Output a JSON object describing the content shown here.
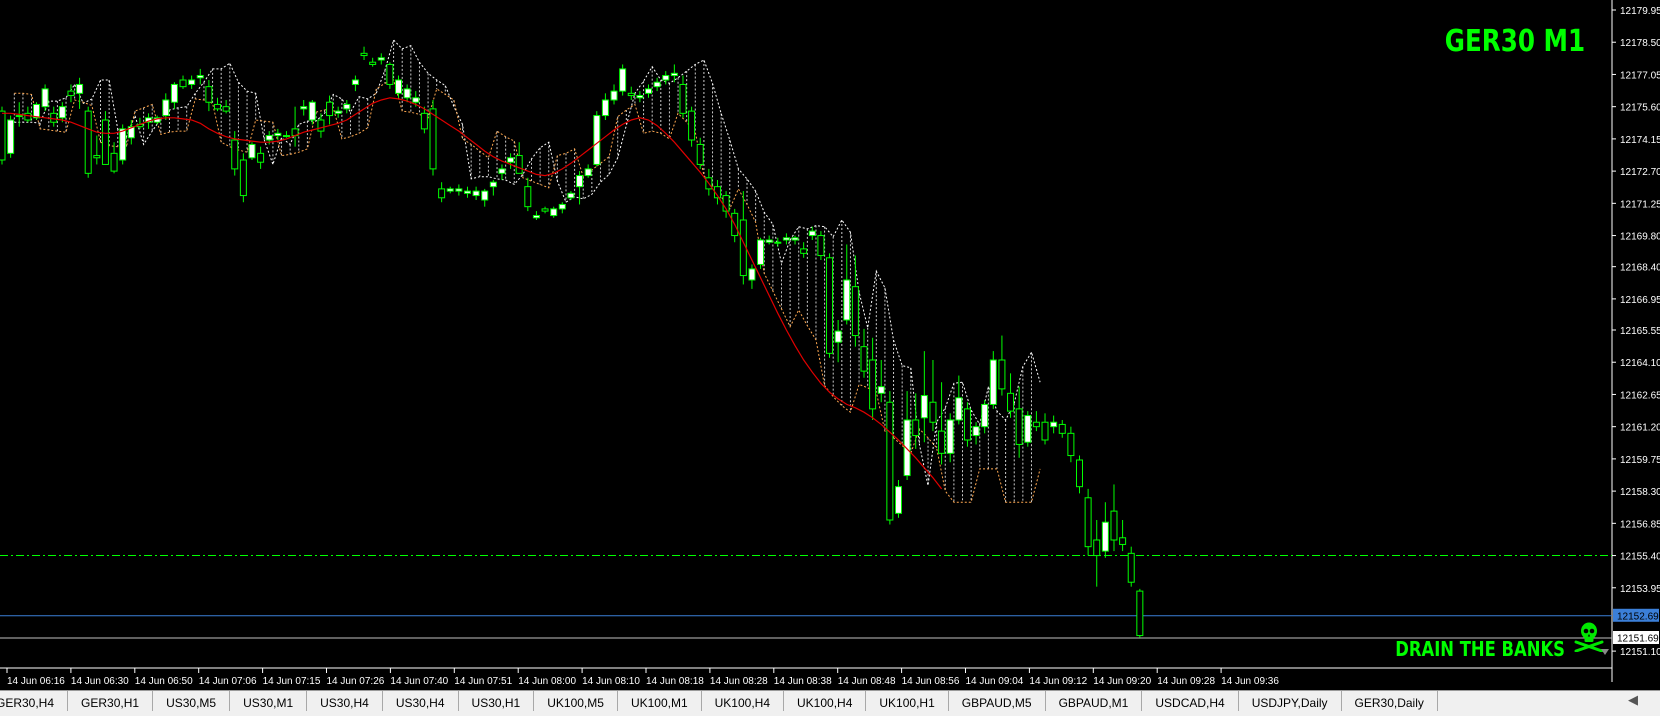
{
  "window": {
    "title": "GER30 M1"
  },
  "watermark": {
    "text": "DRAIN THE BANKS"
  },
  "colors": {
    "background": "#000000",
    "bull_candle": "#ffffff",
    "bear_candle": "#00ff00",
    "wick": "#00ff00",
    "moving_average": "#e00000",
    "cloud_a": "#ffffff",
    "cloud_b": "#ffa850",
    "current_price_line": "#3b7fd8",
    "level_line": "#00ff00",
    "axis_text": "#ffffff"
  },
  "chart_data": {
    "type": "candlestick",
    "symbol": "GER30",
    "timeframe": "M1",
    "y_ticks": [
      "12179.95",
      "12178.50",
      "12177.05",
      "12175.60",
      "12174.15",
      "12172.70",
      "12171.25",
      "12169.80",
      "12168.40",
      "12166.95",
      "12165.55",
      "12164.10",
      "12162.65",
      "12161.20",
      "12159.75",
      "12158.30",
      "12156.85",
      "12155.40",
      "12153.95",
      "12151.10"
    ],
    "x_ticks": [
      "14 Jun 06:16",
      "14 Jun 06:30",
      "14 Jun 06:50",
      "14 Jun 07:06",
      "14 Jun 07:15",
      "14 Jun 07:26",
      "14 Jun 07:40",
      "14 Jun 07:51",
      "14 Jun 08:00",
      "14 Jun 08:10",
      "14 Jun 08:18",
      "14 Jun 08:28",
      "14 Jun 08:38",
      "14 Jun 08:48",
      "14 Jun 08:56",
      "14 Jun 09:04",
      "14 Jun 09:12",
      "14 Jun 09:20",
      "14 Jun 09:28",
      "14 Jun 09:36"
    ],
    "ylim": [
      12150.7,
      12180.4
    ],
    "price_labels": [
      {
        "value": "12152.69",
        "y": 12152.69,
        "kind": "current"
      },
      {
        "value": "12151.69",
        "y": 12151.69,
        "kind": "bid"
      }
    ],
    "level_line_y": 12155.4,
    "candles": [
      [
        12175.4,
        12175.6,
        12173.0,
        12173.2
      ],
      [
        12173.5,
        12175.2,
        12173.3,
        12175.0
      ],
      [
        12175.2,
        12175.8,
        12174.7,
        12175.2
      ],
      [
        12175.3,
        12175.6,
        12174.9,
        12175.0
      ],
      [
        12175.1,
        12175.8,
        12175.0,
        12175.7
      ],
      [
        12175.6,
        12176.6,
        12175.4,
        12176.4
      ],
      [
        12175.3,
        12175.6,
        12174.7,
        12174.9
      ],
      [
        12175.1,
        12175.8,
        12174.9,
        12175.6
      ],
      [
        12176.3,
        12176.6,
        12175.8,
        12176.1
      ],
      [
        12176.2,
        12176.9,
        12175.5,
        12176.6
      ],
      [
        12175.4,
        12175.6,
        12172.4,
        12172.6
      ],
      [
        12173.4,
        12174.3,
        12173.0,
        12173.3
      ],
      [
        12175.0,
        12175.4,
        12173.8,
        12173.0
      ],
      [
        12173.5,
        12174.0,
        12172.6,
        12172.7
      ],
      [
        12173.2,
        12174.8,
        12173.0,
        12174.6
      ],
      [
        12174.2,
        12175.0,
        12173.9,
        12174.7
      ],
      [
        12174.8,
        12175.1,
        12174.6,
        12174.7
      ],
      [
        12174.9,
        12175.3,
        12174.6,
        12175.1
      ],
      [
        12174.9,
        12175.2,
        12174.8,
        12175.1
      ],
      [
        12175.2,
        12176.2,
        12175.0,
        12175.9
      ],
      [
        12175.8,
        12176.7,
        12175.5,
        12176.6
      ],
      [
        12176.8,
        12177.0,
        12176.4,
        12176.5
      ],
      [
        12176.6,
        12177.0,
        12176.4,
        12176.8
      ],
      [
        12176.9,
        12177.3,
        12176.6,
        12177.0
      ],
      [
        12176.5,
        12176.8,
        12175.4,
        12175.8
      ],
      [
        12175.7,
        12176.0,
        12175.4,
        12175.5
      ],
      [
        12175.6,
        12175.9,
        12175.3,
        12175.4
      ],
      [
        12174.1,
        12174.5,
        12172.5,
        12172.8
      ],
      [
        12173.2,
        12173.5,
        12171.3,
        12171.6
      ],
      [
        12173.3,
        12174.0,
        12173.2,
        12173.9
      ],
      [
        12173.5,
        12173.8,
        12172.8,
        12173.1
      ],
      [
        12174.1,
        12174.5,
        12173.9,
        12174.3
      ],
      [
        12174.3,
        12174.6,
        12174.1,
        12174.4
      ],
      [
        12174.3,
        12174.5,
        12174.2,
        12174.3
      ],
      [
        12174.6,
        12175.6,
        12173.8,
        12174.3
      ],
      [
        12175.5,
        12175.9,
        12175.2,
        12175.6
      ],
      [
        12175.0,
        12175.9,
        12174.8,
        12175.8
      ],
      [
        12175.0,
        12175.3,
        12174.2,
        12174.5
      ],
      [
        12175.8,
        12176.1,
        12174.8,
        12175.2
      ],
      [
        12175.3,
        12175.6,
        12175.1,
        12175.4
      ],
      [
        12175.5,
        12175.9,
        12175.3,
        12175.7
      ],
      [
        12176.6,
        12177.0,
        12176.3,
        12176.8
      ],
      [
        12178.0,
        12178.3,
        12177.7,
        12177.9
      ],
      [
        12177.6,
        12177.8,
        12177.4,
        12177.5
      ],
      [
        12177.7,
        12178.0,
        12177.5,
        12177.8
      ],
      [
        12177.5,
        12177.6,
        12176.4,
        12176.6
      ],
      [
        12176.2,
        12177.0,
        12176.0,
        12176.8
      ],
      [
        12176.0,
        12176.6,
        12175.8,
        12176.4
      ],
      [
        12175.8,
        12176.3,
        12175.6,
        12176.0
      ],
      [
        12175.3,
        12175.6,
        12174.4,
        12174.6
      ],
      [
        12175.5,
        12175.9,
        12172.5,
        12172.8
      ],
      [
        12171.9,
        12172.2,
        12171.3,
        12171.5
      ],
      [
        12171.8,
        12172.0,
        12171.7,
        12171.9
      ],
      [
        12171.8,
        12172.1,
        12171.6,
        12171.9
      ],
      [
        12171.7,
        12172.0,
        12171.5,
        12171.8
      ],
      [
        12171.6,
        12172.0,
        12171.4,
        12171.8
      ],
      [
        12171.4,
        12171.9,
        12171.1,
        12171.8
      ],
      [
        12172.0,
        12172.3,
        12171.6,
        12172.2
      ],
      [
        12172.6,
        12173.0,
        12172.3,
        12172.8
      ],
      [
        12173.1,
        12173.5,
        12172.8,
        12173.3
      ],
      [
        12173.4,
        12174.0,
        12172.8,
        12172.6
      ],
      [
        12172.0,
        12172.4,
        12170.9,
        12171.1
      ],
      [
        12170.6,
        12170.9,
        12170.5,
        12170.7
      ],
      [
        12171.0,
        12171.1,
        12170.8,
        12170.9
      ],
      [
        12170.7,
        12171.1,
        12170.6,
        12171.0
      ],
      [
        12171.0,
        12171.3,
        12170.8,
        12171.2
      ],
      [
        12171.5,
        12171.8,
        12171.4,
        12171.7
      ],
      [
        12172.0,
        12172.7,
        12171.2,
        12172.5
      ],
      [
        12172.5,
        12173.0,
        12172.4,
        12172.8
      ],
      [
        12173.0,
        12175.4,
        12172.9,
        12175.2
      ],
      [
        12175.2,
        12176.2,
        12175.0,
        12175.9
      ],
      [
        12175.9,
        12176.6,
        12175.7,
        12176.3
      ],
      [
        12176.3,
        12177.5,
        12176.1,
        12177.3
      ],
      [
        12176.2,
        12176.5,
        12175.9,
        12176.1
      ],
      [
        12176.0,
        12176.3,
        12175.8,
        12176.1
      ],
      [
        12176.2,
        12176.6,
        12176.0,
        12176.4
      ],
      [
        12176.5,
        12176.9,
        12176.3,
        12176.7
      ],
      [
        12176.8,
        12177.2,
        12176.6,
        12177.0
      ],
      [
        12177.0,
        12177.5,
        12176.7,
        12177.1
      ],
      [
        12176.6,
        12177.0,
        12175.1,
        12175.3
      ],
      [
        12175.4,
        12175.6,
        12173.8,
        12174.1
      ],
      [
        12173.9,
        12174.2,
        12172.8,
        12173.0
      ],
      [
        12172.4,
        12172.8,
        12171.6,
        12171.9
      ],
      [
        12172.0,
        12172.3,
        12171.2,
        12171.5
      ],
      [
        12171.6,
        12171.8,
        12170.6,
        12170.9
      ],
      [
        12170.8,
        12171.0,
        12169.5,
        12169.8
      ],
      [
        12170.5,
        12171.8,
        12167.6,
        12168.0
      ],
      [
        12167.8,
        12168.5,
        12167.4,
        12168.3
      ],
      [
        12168.5,
        12169.7,
        12168.3,
        12169.6
      ],
      [
        12169.5,
        12169.8,
        12169.4,
        12169.6
      ],
      [
        12169.5,
        12169.7,
        12169.3,
        12169.5
      ],
      [
        12169.6,
        12169.9,
        12169.4,
        12169.7
      ],
      [
        12169.6,
        12169.8,
        12169.4,
        12169.7
      ],
      [
        12169.2,
        12169.5,
        12168.8,
        12169.0
      ],
      [
        12169.8,
        12170.2,
        12169.6,
        12170.0
      ],
      [
        12169.8,
        12170.0,
        12168.7,
        12168.9
      ],
      [
        12168.8,
        12169.0,
        12164.3,
        12164.5
      ],
      [
        12165.0,
        12166.0,
        12164.1,
        12165.5
      ],
      [
        12166.0,
        12169.4,
        12165.8,
        12167.8
      ],
      [
        12167.5,
        12168.9,
        12164.8,
        12165.3
      ],
      [
        12164.8,
        12165.6,
        12163.4,
        12163.7
      ],
      [
        12164.2,
        12165.2,
        12161.5,
        12162.0
      ],
      [
        12162.7,
        12164.2,
        12162.3,
        12163.0
      ],
      [
        12162.3,
        12162.8,
        12156.8,
        12157.0
      ],
      [
        12157.3,
        12158.8,
        12157.1,
        12158.5
      ],
      [
        12159.0,
        12162.8,
        12158.8,
        12161.5
      ],
      [
        12161.5,
        12162.7,
        12160.2,
        12160.8
      ],
      [
        12161.6,
        12164.6,
        12160.5,
        12162.6
      ],
      [
        12162.3,
        12164.2,
        12161.0,
        12161.4
      ],
      [
        12161.0,
        12163.2,
        12159.5,
        12160.0
      ],
      [
        12160.0,
        12161.8,
        12159.6,
        12161.5
      ],
      [
        12161.5,
        12163.5,
        12161.3,
        12162.5
      ],
      [
        12162.0,
        12162.3,
        12160.3,
        12160.6
      ],
      [
        12160.8,
        12161.4,
        12160.4,
        12161.2
      ],
      [
        12161.2,
        12162.4,
        12160.9,
        12162.2
      ],
      [
        12162.2,
        12164.6,
        12162.0,
        12164.2
      ],
      [
        12164.2,
        12165.3,
        12162.6,
        12162.9
      ],
      [
        12162.7,
        12163.6,
        12161.6,
        12161.9
      ],
      [
        12162.0,
        12163.0,
        12159.8,
        12160.4
      ],
      [
        12160.5,
        12161.9,
        12160.3,
        12161.7
      ],
      [
        12161.4,
        12161.9,
        12161.0,
        12161.2
      ],
      [
        12161.4,
        12161.8,
        12160.4,
        12160.6
      ],
      [
        12161.2,
        12161.7,
        12160.9,
        12161.4
      ],
      [
        12161.3,
        12161.5,
        12160.7,
        12160.9
      ],
      [
        12160.9,
        12161.2,
        12159.6,
        12159.9
      ],
      [
        12159.7,
        12159.9,
        12158.2,
        12158.5
      ],
      [
        12158.0,
        12158.4,
        12155.4,
        12155.8
      ],
      [
        12156.1,
        12157.0,
        12154.0,
        12155.4
      ],
      [
        12155.6,
        12157.8,
        12155.3,
        12156.9
      ],
      [
        12157.4,
        12158.6,
        12155.6,
        12156.1
      ],
      [
        12156.2,
        12157.0,
        12155.6,
        12155.9
      ],
      [
        12155.5,
        12155.8,
        12154.0,
        12154.2
      ],
      [
        12153.8,
        12153.9,
        12151.7,
        12151.8
      ]
    ],
    "moving_average": [
      12175.3,
      12175.3,
      12175.25,
      12175.2,
      12175.15,
      12175.1,
      12175.05,
      12175.0,
      12174.9,
      12174.75,
      12174.6,
      12174.45,
      12174.4,
      12174.4,
      12174.5,
      12174.65,
      12174.8,
      12174.95,
      12175.05,
      12175.1,
      12175.1,
      12175.05,
      12175.0,
      12174.85,
      12174.6,
      12174.4,
      12174.25,
      12174.15,
      12174.1,
      12174.05,
      12174.0,
      12174.0,
      12174.05,
      12174.15,
      12174.3,
      12174.45,
      12174.55,
      12174.65,
      12174.75,
      12174.85,
      12175.0,
      12175.25,
      12175.5,
      12175.75,
      12175.9,
      12176.0,
      12175.95,
      12175.85,
      12175.7,
      12175.5,
      12175.25,
      12175.0,
      12174.75,
      12174.5,
      12174.2,
      12173.9,
      12173.6,
      12173.35,
      12173.15,
      12173.0,
      12172.85,
      12172.7,
      12172.55,
      12172.5,
      12172.6,
      12172.8,
      12173.05,
      12173.35,
      12173.65,
      12173.95,
      12174.25,
      12174.55,
      12174.8,
      12175.0,
      12175.1,
      12175.0,
      12174.75,
      12174.4,
      12174.0,
      12173.55,
      12173.1,
      12172.65,
      12172.15,
      12171.6,
      12171.0,
      12170.3,
      12169.5,
      12168.7,
      12167.9,
      12167.1,
      12166.3,
      12165.55,
      12164.85,
      12164.2,
      12163.65,
      12163.15,
      12162.75,
      12162.45,
      12162.2,
      12162.05,
      12161.85,
      12161.6,
      12161.3,
      12160.95,
      12160.6,
      12160.2,
      12159.8,
      12159.35,
      12158.9,
      12158.4
    ]
  }
}
